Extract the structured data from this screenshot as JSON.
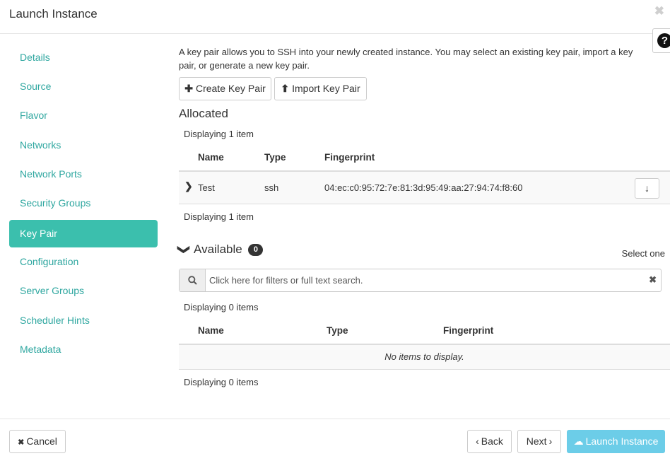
{
  "modal": {
    "title": "Launch Instance",
    "close_glyph": "✖",
    "help_glyph": "?"
  },
  "sidebar": {
    "active_color": "#3bbfad",
    "items": [
      {
        "label": "Details"
      },
      {
        "label": "Source"
      },
      {
        "label": "Flavor"
      },
      {
        "label": "Networks"
      },
      {
        "label": "Network Ports"
      },
      {
        "label": "Security Groups"
      },
      {
        "label": "Key Pair",
        "active": true
      },
      {
        "label": "Configuration"
      },
      {
        "label": "Server Groups"
      },
      {
        "label": "Scheduler Hints"
      },
      {
        "label": "Metadata"
      }
    ]
  },
  "main": {
    "intro": "A key pair allows you to SSH into your newly created instance. You may select an existing key pair, import a key pair, or generate a new key pair.",
    "create_key_pair": {
      "icon": "plus-icon",
      "glyph": "✚",
      "label": "Create Key Pair"
    },
    "import_key_pair": {
      "icon": "upload-icon",
      "glyph": "⬆",
      "label": "Import Key Pair"
    },
    "allocated": {
      "title": "Allocated",
      "count_top": "Displaying 1 item",
      "columns": [
        "Name",
        "Type",
        "Fingerprint"
      ],
      "rows": [
        {
          "name": "Test",
          "type": "ssh",
          "fingerprint": "04:ec:c0:95:72:7e:81:3d:95:49:aa:27:94:74:f8:60"
        }
      ],
      "row_action_glyph": "↓",
      "count_bottom": "Displaying 1 item"
    },
    "available": {
      "chevron_glyph": "❯",
      "title": "Available",
      "badge": "0",
      "select_hint": "Select one",
      "search_placeholder": "Click here for filters or full text search.",
      "search_icon": "search-icon",
      "clear_glyph": "✖",
      "count_top": "Displaying 0 items",
      "columns": [
        "Name",
        "Type",
        "Fingerprint"
      ],
      "empty_text": "No items to display.",
      "count_bottom": "Displaying 0 items"
    }
  },
  "footer": {
    "cancel": {
      "glyph": "✖",
      "label": "Cancel"
    },
    "back": {
      "glyph": "‹",
      "label": "Back"
    },
    "next": {
      "glyph": "›",
      "label": "Next"
    },
    "launch": {
      "glyph": "☁",
      "label": "Launch Instance",
      "color": "#6ccde8"
    }
  }
}
